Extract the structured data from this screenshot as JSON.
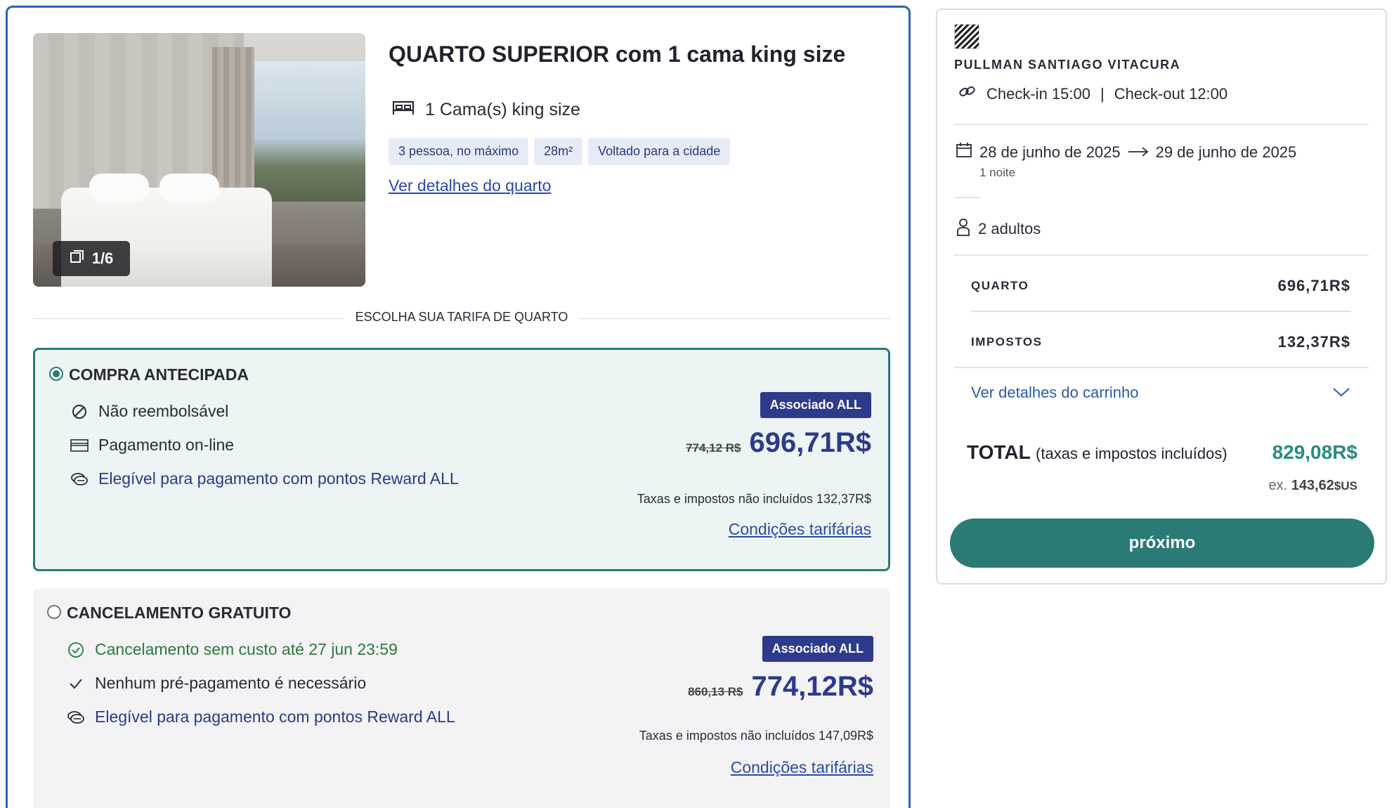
{
  "room": {
    "title": "QUARTO SUPERIOR com 1 cama king size",
    "photo_counter": "1/6",
    "bed": "1 Cama(s) king size",
    "chips": [
      "3 pessoa, no máximo",
      "28m²",
      "Voltado para a cidade"
    ],
    "details_link": "Ver detalhes do quarto",
    "rate_section_label": "ESCOLHA SUA TARIFA DE QUARTO"
  },
  "rates": [
    {
      "name": "COMPRA ANTECIPADA",
      "selected": true,
      "features": [
        {
          "icon": "no-refund-icon",
          "text": "Não reembolsável"
        },
        {
          "icon": "credit-card-icon",
          "text": "Pagamento on-line"
        },
        {
          "icon": "reward-points-icon",
          "text": "Elegível para pagamento com pontos Reward ALL"
        }
      ],
      "member_badge": "Associado ALL",
      "old_price": "774,12 R$",
      "price": "696,71R$",
      "tax_note": "Taxas e impostos não incluídos 132,37R$",
      "conditions_link": "Condições tarifárias"
    },
    {
      "name": "CANCELAMENTO GRATUITO",
      "selected": false,
      "features": [
        {
          "icon": "check-circle-icon",
          "text": "Cancelamento sem custo até 27 jun 23:59"
        },
        {
          "icon": "checkmark-icon",
          "text": "Nenhum pré-pagamento é necessário"
        },
        {
          "icon": "reward-points-icon",
          "text": "Elegível para pagamento com pontos Reward ALL"
        }
      ],
      "member_badge": "Associado ALL",
      "old_price": "860,13 R$",
      "price": "774,12R$",
      "tax_note": "Taxas e impostos não incluídos 147,09R$",
      "conditions_link": "Condições tarifárias"
    }
  ],
  "summary": {
    "hotel_name": "PULLMAN SANTIAGO VITACURA",
    "checkin": "Check-in 15:00",
    "separator": "|",
    "checkout": "Check-out 12:00",
    "date_from": "28 de junho de 2025",
    "date_to": "29 de junho de 2025",
    "nights": "1 noite",
    "guests": "2 adultos",
    "room_label": "QUARTO",
    "room_value": "696,71R$",
    "tax_label": "IMPOSTOS",
    "tax_value": "132,37R$",
    "cart_link": "Ver detalhes do carrinho",
    "total_label": "TOTAL",
    "total_sub": "(taxas e impostos incluídos)",
    "total_value": "829,08R$",
    "total_ex_prefix": "ex.",
    "total_ex_value": "143,62",
    "total_ex_currency": "$US",
    "next_button": "próximo"
  },
  "colors": {
    "primary_blue": "#2e3a8c",
    "teal": "#2a7a76",
    "link_blue": "#2a4aa8",
    "card_border": "#2e64b5"
  }
}
